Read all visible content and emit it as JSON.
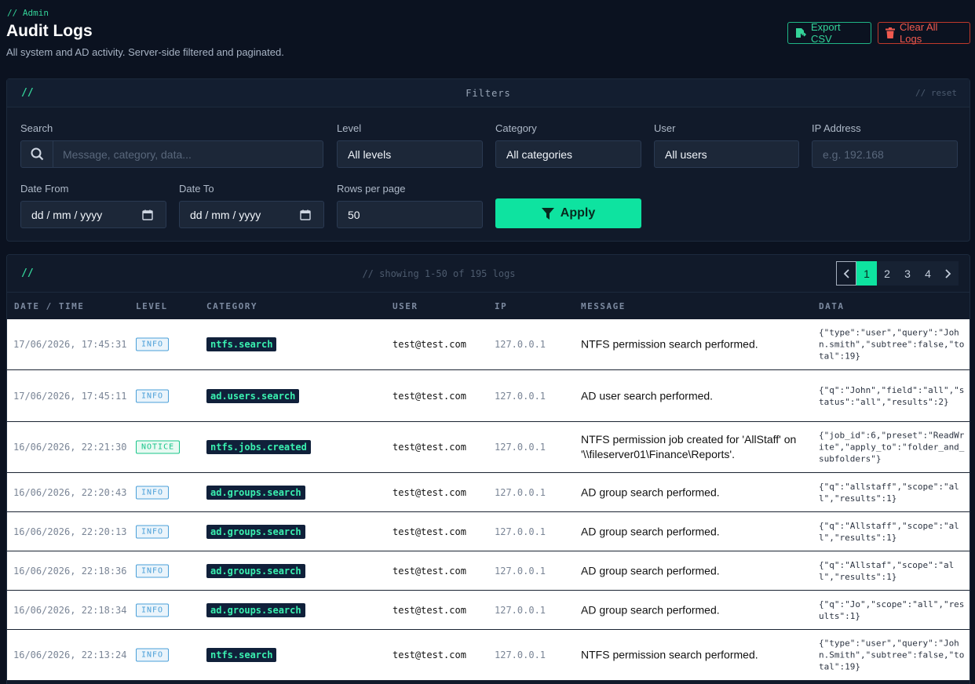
{
  "header": {
    "breadcrumb": "// Admin",
    "title": "Audit Logs",
    "subtitle": "All system and AD activity. Server-side filtered and paginated.",
    "export_label": "Export CSV",
    "clear_label": "Clear All Logs"
  },
  "filters": {
    "prefix": "//",
    "title": "Filters",
    "reset_label": "// reset",
    "search": {
      "label": "Search",
      "placeholder": "Message, category, data..."
    },
    "level": {
      "label": "Level",
      "value": "All levels"
    },
    "category": {
      "label": "Category",
      "value": "All categories"
    },
    "user": {
      "label": "User",
      "value": "All users"
    },
    "ip": {
      "label": "IP Address",
      "placeholder": "e.g. 192.168"
    },
    "date_from": {
      "label": "Date From",
      "value": "dd / mm / yyyy"
    },
    "date_to": {
      "label": "Date To",
      "value": "dd / mm / yyyy"
    },
    "rows_per_page": {
      "label": "Rows per page",
      "value": "50"
    },
    "apply_label": "Apply"
  },
  "logs": {
    "prefix": "//",
    "showing": "// showing 1-50 of 195 logs",
    "pagination": {
      "pages": [
        "1",
        "2",
        "3",
        "4"
      ],
      "active": "1"
    },
    "columns": [
      "DATE / TIME",
      "LEVEL",
      "CATEGORY",
      "USER",
      "IP",
      "MESSAGE",
      "DATA"
    ],
    "rows": [
      {
        "date": "17/06/2026, 17:45:31",
        "level": "INFO",
        "category": "ntfs.search",
        "user": "test@test.com",
        "ip": "127.0.0.1",
        "message": "NTFS permission search performed.",
        "data": "{\"type\":\"user\",\"query\":\"John.smith\",\"subtree\":false,\"total\":19}"
      },
      {
        "date": "17/06/2026, 17:45:11",
        "level": "INFO",
        "category": "ad.users.search",
        "user": "test@test.com",
        "ip": "127.0.0.1",
        "message": "AD user search performed.",
        "data": "{\"q\":\"John\",\"field\":\"all\",\"status\":\"all\",\"results\":2}"
      },
      {
        "date": "16/06/2026, 22:21:30",
        "level": "NOTICE",
        "category": "ntfs.jobs.created",
        "user": "test@test.com",
        "ip": "127.0.0.1",
        "message": "NTFS permission job created for 'AllStaff' on '\\\\fileserver01\\Finance\\Reports'.",
        "data": "{\"job_id\":6,\"preset\":\"ReadWrite\",\"apply_to\":\"folder_and_subfolders\"}"
      },
      {
        "date": "16/06/2026, 22:20:43",
        "level": "INFO",
        "category": "ad.groups.search",
        "user": "test@test.com",
        "ip": "127.0.0.1",
        "message": "AD group search performed.",
        "data": "{\"q\":\"allstaff\",\"scope\":\"all\",\"results\":1}"
      },
      {
        "date": "16/06/2026, 22:20:13",
        "level": "INFO",
        "category": "ad.groups.search",
        "user": "test@test.com",
        "ip": "127.0.0.1",
        "message": "AD group search performed.",
        "data": "{\"q\":\"Allstaff\",\"scope\":\"all\",\"results\":1}"
      },
      {
        "date": "16/06/2026, 22:18:36",
        "level": "INFO",
        "category": "ad.groups.search",
        "user": "test@test.com",
        "ip": "127.0.0.1",
        "message": "AD group search performed.",
        "data": "{\"q\":\"Allstaf\",\"scope\":\"all\",\"results\":1}"
      },
      {
        "date": "16/06/2026, 22:18:34",
        "level": "INFO",
        "category": "ad.groups.search",
        "user": "test@test.com",
        "ip": "127.0.0.1",
        "message": "AD group search performed.",
        "data": "{\"q\":\"Jo\",\"scope\":\"all\",\"results\":1}"
      },
      {
        "date": "16/06/2026, 22:13:24",
        "level": "INFO",
        "category": "ntfs.search",
        "user": "test@test.com",
        "ip": "127.0.0.1",
        "message": "NTFS permission search performed.",
        "data": "{\"type\":\"user\",\"query\":\"John.Smith\",\"subtree\":false,\"total\":19}"
      }
    ]
  },
  "colors": {
    "accent": "#0ee3a0",
    "danger": "#f05a4f",
    "background": "#0b1220",
    "info": "#4a9fd8",
    "notice": "#18c48a"
  }
}
